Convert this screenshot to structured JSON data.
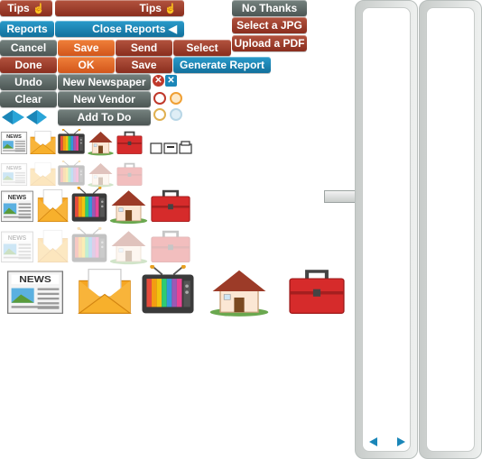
{
  "buttons": {
    "tips_small": "Tips",
    "tips_wide": "Tips",
    "no_thanks": "No Thanks",
    "reports": "Reports",
    "close_reports": "Close Reports",
    "select_jpg": "Select a JPG",
    "upload_pdf": "Upload a PDF",
    "cancel": "Cancel",
    "save_orange": "Save",
    "send": "Send",
    "select": "Select",
    "done": "Done",
    "ok": "OK",
    "save_red": "Save",
    "generate_report": "Generate Report",
    "undo": "Undo",
    "new_newspaper": "New Newspaper",
    "clear": "Clear",
    "new_vendor": "New Vendor",
    "add_to_do": "Add To Do"
  },
  "icons": {
    "newspaper_label": "NEWS",
    "rows": [
      "normal",
      "faded",
      "normal",
      "faded",
      "large"
    ],
    "set": [
      "newspaper-icon",
      "mail-icon",
      "tv-icon",
      "house-icon",
      "toolbox-icon"
    ]
  },
  "colors": {
    "red": "#9c3b28",
    "gray": "#5e6a67",
    "blue": "#1a86b8",
    "orange": "#e66a28"
  }
}
